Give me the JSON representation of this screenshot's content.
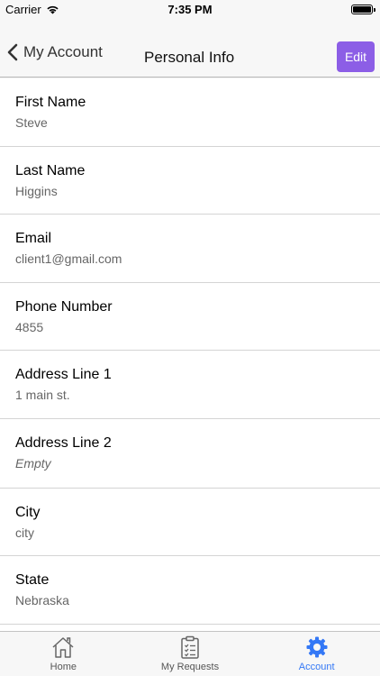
{
  "status": {
    "carrier": "Carrier",
    "time": "7:35 PM"
  },
  "nav": {
    "back_label": "My Account",
    "title": "Personal Info",
    "edit_label": "Edit"
  },
  "fields": [
    {
      "label": "First Name",
      "value": "Steve"
    },
    {
      "label": "Last Name",
      "value": "Higgins"
    },
    {
      "label": "Email",
      "value": "client1@gmail.com"
    },
    {
      "label": "Phone Number",
      "value": "4855"
    },
    {
      "label": "Address Line 1",
      "value": "1 main st."
    },
    {
      "label": "Address Line 2",
      "value": "Empty"
    },
    {
      "label": "City",
      "value": "city"
    },
    {
      "label": "State",
      "value": "Nebraska"
    }
  ],
  "tabs": [
    {
      "label": "Home",
      "icon": "home-icon"
    },
    {
      "label": "My Requests",
      "icon": "clipboard-icon"
    },
    {
      "label": "Account",
      "icon": "gear-icon"
    }
  ],
  "colors": {
    "accent": "#8c5ee6",
    "tab_active": "#3478f6"
  }
}
